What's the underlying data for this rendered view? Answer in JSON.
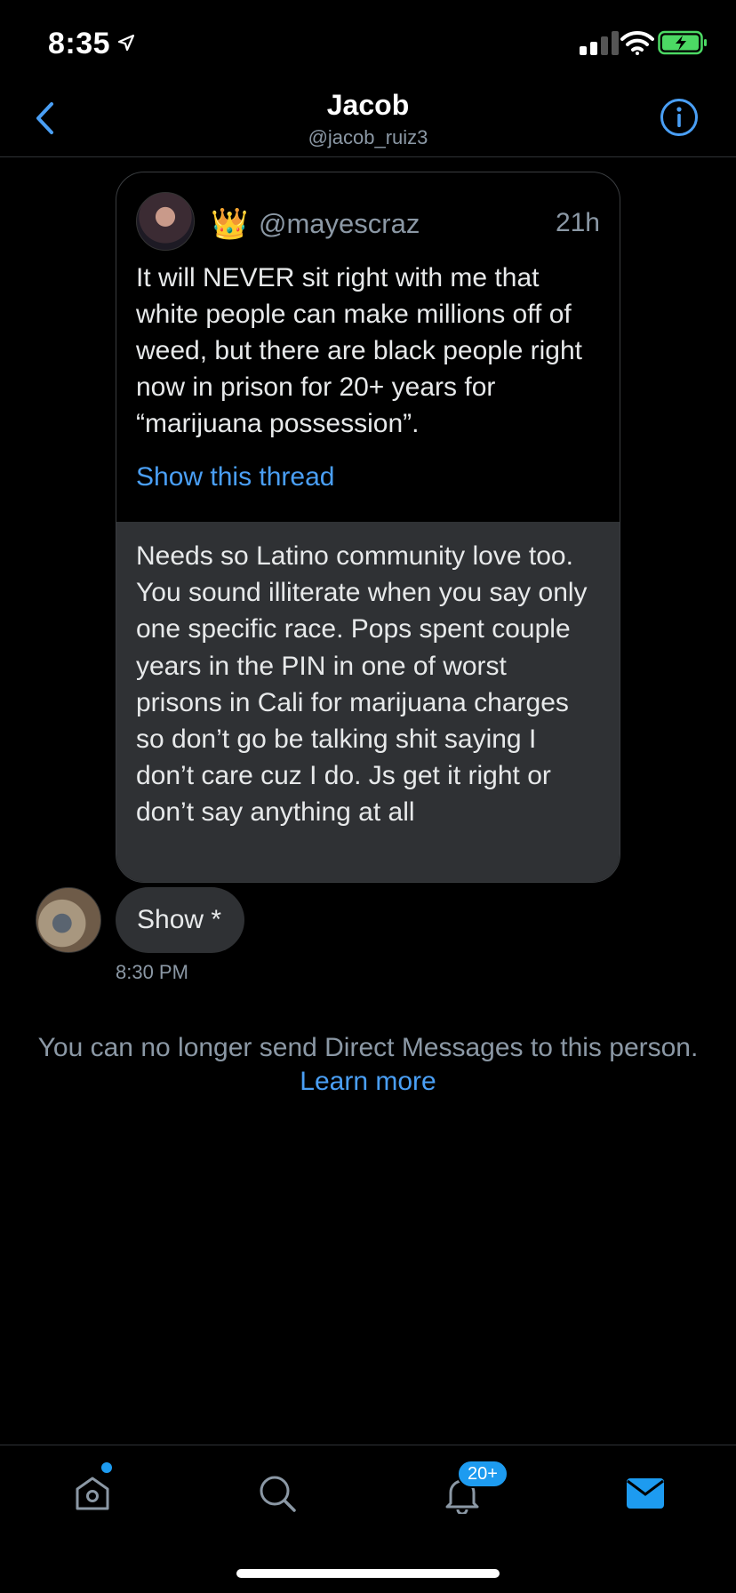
{
  "status_bar": {
    "time": "8:35",
    "battery_color": "#4cd964"
  },
  "header": {
    "name": "Jacob",
    "handle": "@jacob_ruiz3",
    "accent": "#4a9ff5"
  },
  "quoted_tweet": {
    "emoji": "👑",
    "username": "@mayescraz",
    "age": "21h",
    "text": "It will NEVER sit right with me that white people can make millions off of weed, but there are black people right now in prison for 20+ years for “marijuana possession”.",
    "link": "Show this thread"
  },
  "reply_text": "Needs so Latino community love too. You sound illiterate when you say only one specific race. Pops spent couple years in the PIN in one of worst prisons in Cali for marijuana charges so don’t go be talking shit saying I don’t care cuz I do. Js get it right or don’t say anything at all",
  "message": {
    "text": "Show *",
    "time": "8:30 PM"
  },
  "notice": {
    "text": "You can no longer send Direct Messages to this person.",
    "link": "Learn more"
  },
  "tabbar": {
    "items": [
      "home-icon",
      "search-icon",
      "bell-icon",
      "mail-icon"
    ],
    "notif_badge": "20+",
    "active": "mail-icon"
  }
}
